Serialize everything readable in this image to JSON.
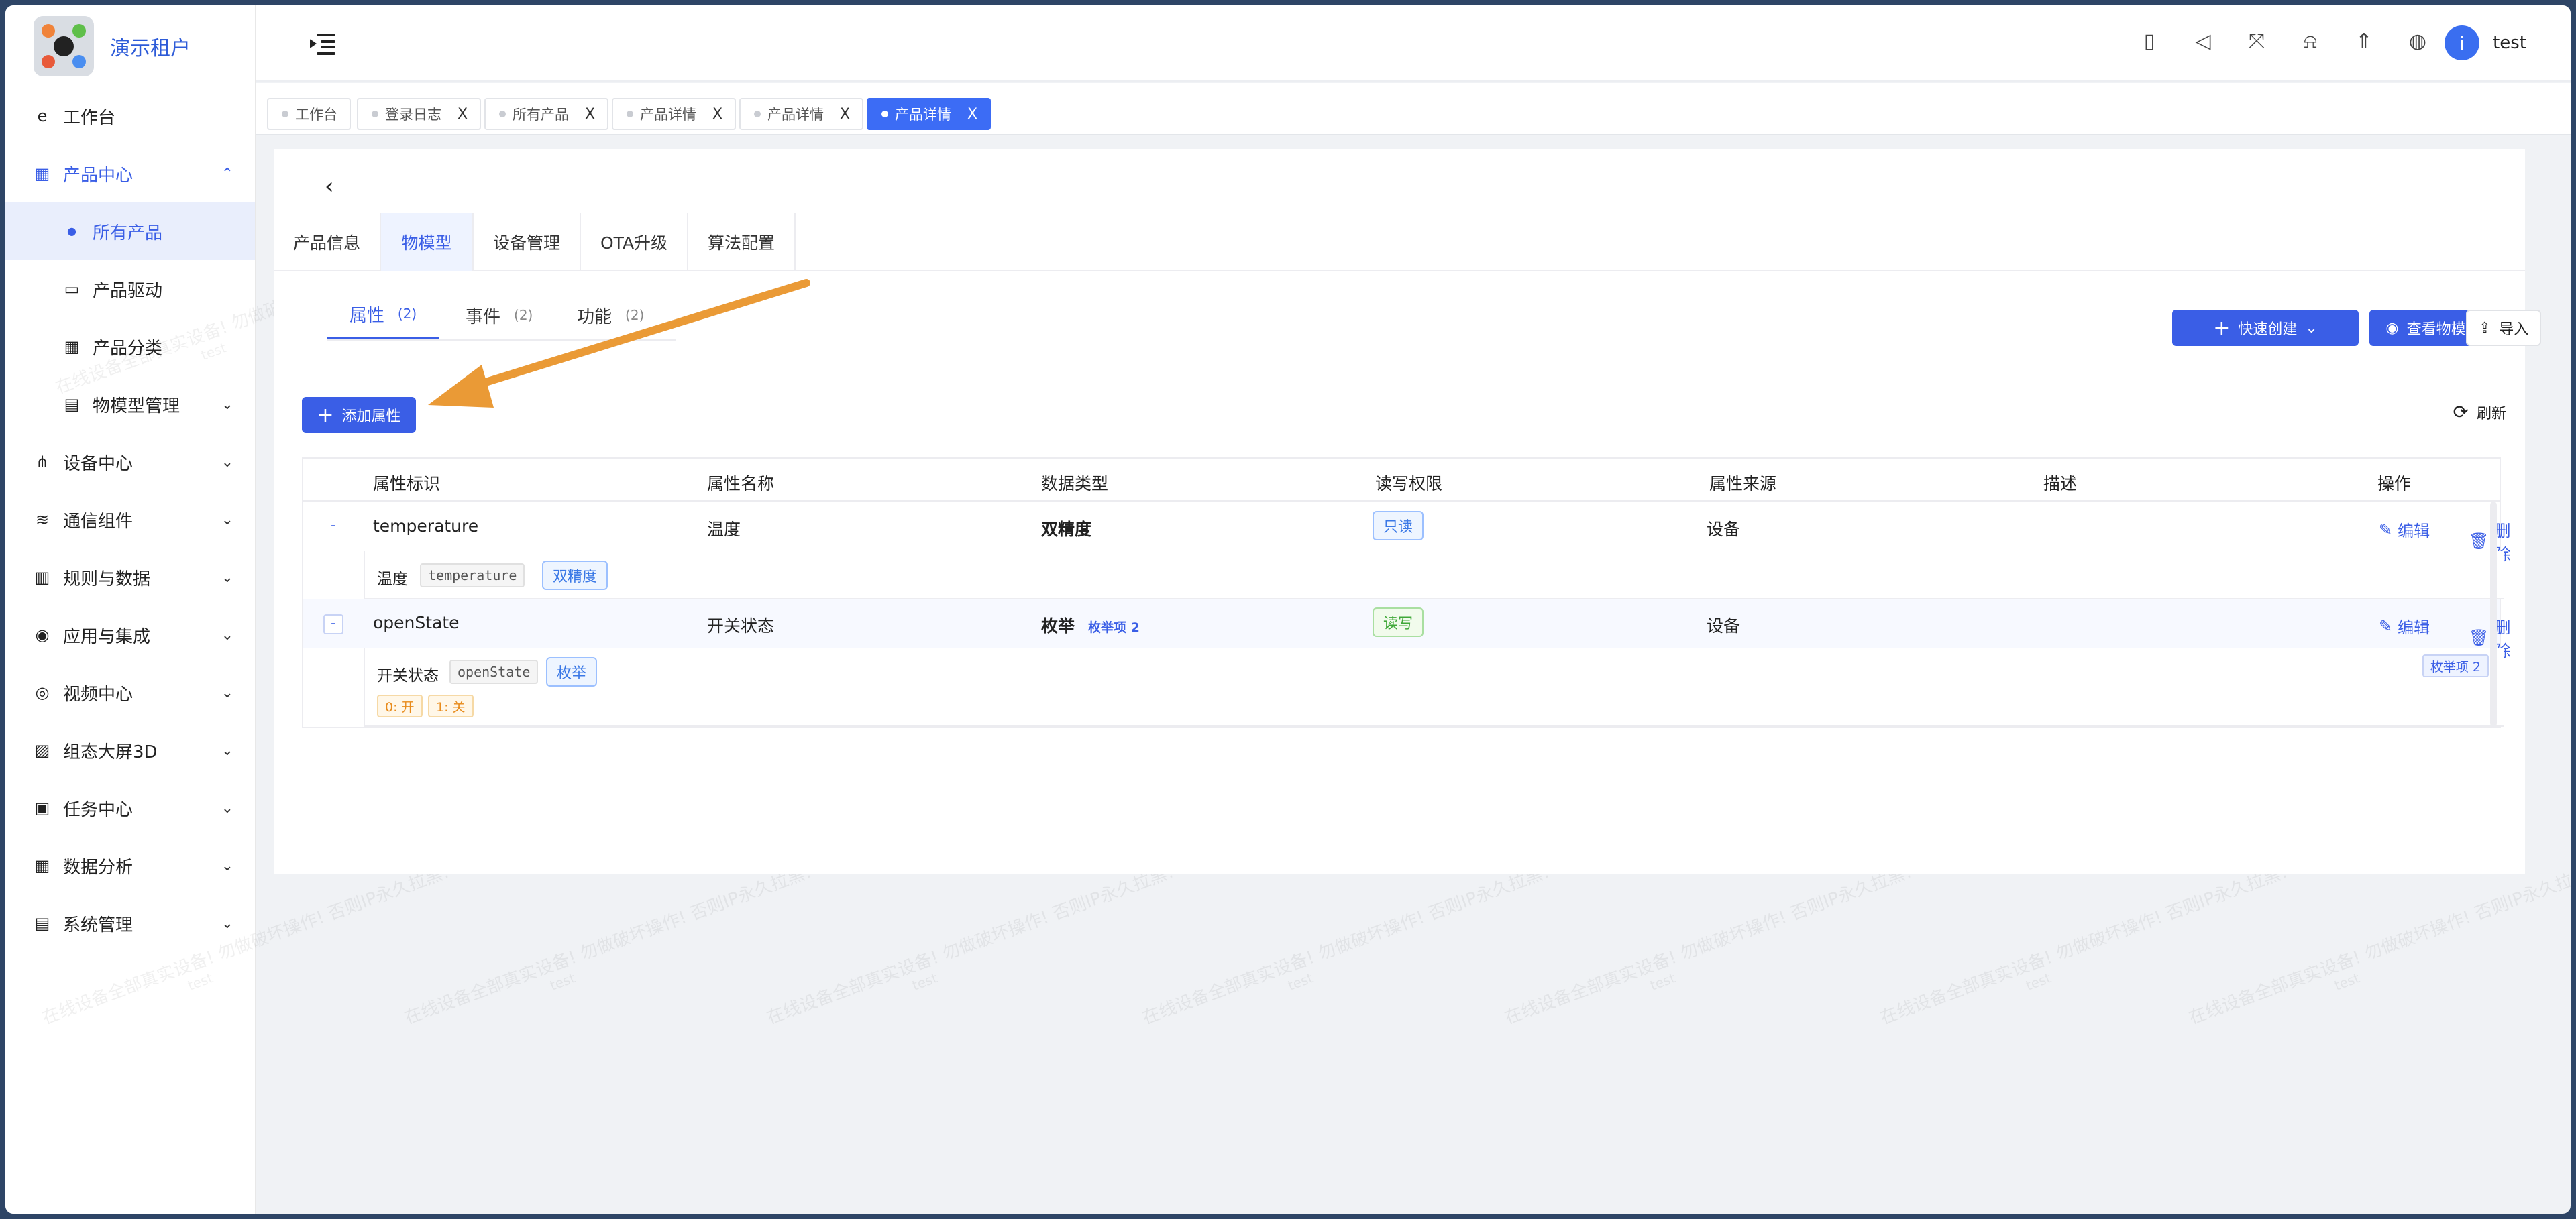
{
  "tenant": "演示租户",
  "sidebar": {
    "items": [
      {
        "label": "工作台",
        "icon": "e"
      },
      {
        "label": "产品中心",
        "icon": "▦"
      },
      {
        "label": "所有产品",
        "icon": "●"
      },
      {
        "label": "产品驱动",
        "icon": "▭"
      },
      {
        "label": "产品分类",
        "icon": "▦"
      },
      {
        "label": "物模型管理",
        "icon": "▤"
      },
      {
        "label": "设备中心",
        "icon": "⋔"
      },
      {
        "label": "通信组件",
        "icon": "≋"
      },
      {
        "label": "规则与数据",
        "icon": "▥"
      },
      {
        "label": "应用与集成",
        "icon": "◉"
      },
      {
        "label": "视频中心",
        "icon": "◎"
      },
      {
        "label": "组态大屏3D",
        "icon": "▨"
      },
      {
        "label": "任务中心",
        "icon": "▣"
      },
      {
        "label": "数据分析",
        "icon": "▦"
      },
      {
        "label": "系统管理",
        "icon": "▤"
      }
    ]
  },
  "header": {
    "user": "test",
    "avatar_glyph": "i"
  },
  "tags": [
    "工作台",
    "登录日志",
    "所有产品",
    "产品详情",
    "产品详情",
    "产品详情"
  ],
  "tag_close": "X",
  "product_tabs": [
    "产品信息",
    "物模型",
    "设备管理",
    "OTA升级",
    "算法配置"
  ],
  "sub_tabs": [
    {
      "label": "属性",
      "count": "(2)"
    },
    {
      "label": "事件",
      "count": "(2)"
    },
    {
      "label": "功能",
      "count": "(2)"
    }
  ],
  "buttons": {
    "quick_create": "快速创建",
    "view_model": "查看物模型",
    "import": "导入",
    "add_property": "添加属性",
    "refresh": "刷新"
  },
  "table": {
    "headers": [
      "属性标识",
      "属性名称",
      "数据类型",
      "读写权限",
      "属性来源",
      "描述",
      "操作"
    ],
    "rows": [
      {
        "id": "temperature",
        "name": "温度",
        "type": "双精度",
        "type_extra": "",
        "rw": "只读",
        "source": "设备",
        "desc": "",
        "expand": "-"
      },
      {
        "id": "openState",
        "name": "开关状态",
        "type": "枚举",
        "type_extra": "枚举项 2",
        "rw": "读写",
        "source": "设备",
        "desc": "",
        "expand": "-"
      }
    ],
    "actions": {
      "edit": "编辑",
      "delete": "删除"
    },
    "details": [
      {
        "name": "温度",
        "code": "temperature",
        "type": "双精度"
      },
      {
        "name": "开关状态",
        "code": "openState",
        "type": "枚举",
        "enum_values": [
          "0: 开",
          "1: 关"
        ],
        "enum_count": "枚举项 2"
      }
    ]
  },
  "watermark": {
    "line1": "在线设备全部真实设备! 勿做破坏操作! 否则IP永久拉黑!",
    "line2": "test"
  },
  "colors": {
    "primary": "#3a5ee6",
    "arrow": "#ea9a36"
  }
}
